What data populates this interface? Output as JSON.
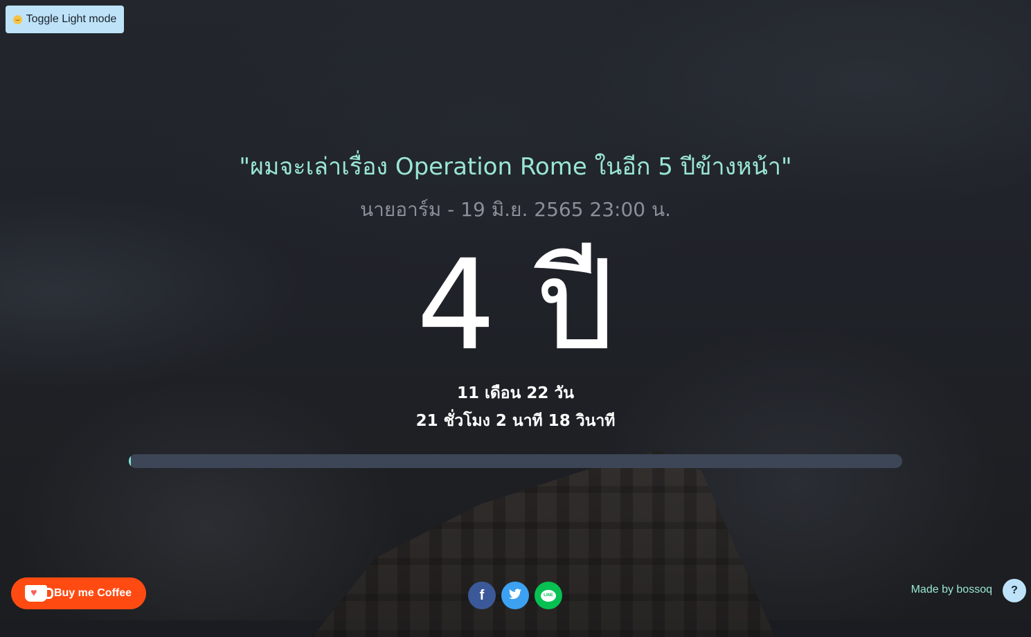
{
  "toggle": {
    "icon": "smiley-sun-icon",
    "label": "Toggle Light mode"
  },
  "quote": "\"ผมจะเล่าเรื่อง Operation Rome ในอีก 5 ปีข้างหน้า\"",
  "author_line": "นายอาร์ม - 19 มิ.ย. 2565 23:00 น.",
  "countdown": {
    "years_display": "4 ปี",
    "line1": "11 เดือน 22 วัน",
    "line2": "21 ชั่วโมง 2 นาที 18 วินาที",
    "progress_fraction": 0.003
  },
  "footer": {
    "coffee_label": "Buy me Coffee",
    "share_icons": [
      "facebook-icon",
      "twitter-icon",
      "line-icon"
    ],
    "made_by": "Made by bossoq",
    "help_label": "?"
  },
  "colors": {
    "accent": "#9ae6d4",
    "progress_track": "#3d4656",
    "progress_fill": "#81e6d9",
    "coffee": "#ff4b12",
    "toggle_bg": "#bee3f8"
  }
}
